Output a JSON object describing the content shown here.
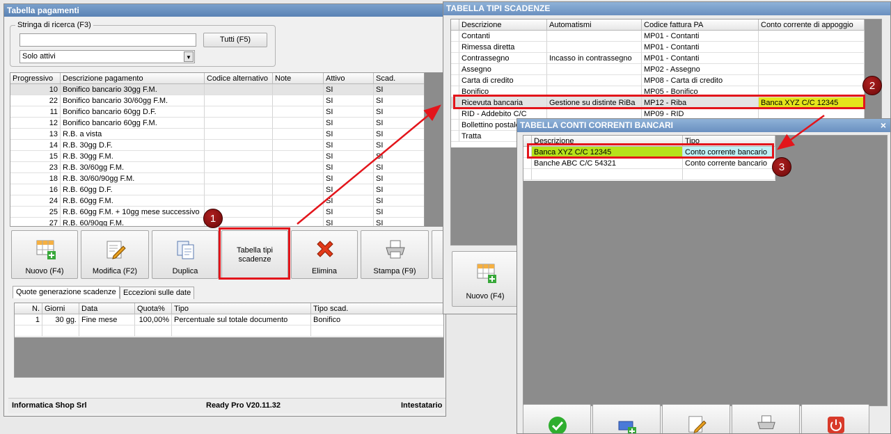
{
  "main": {
    "title": "Tabella pagamenti",
    "search": {
      "group_label": "Stringa di ricerca (F3)",
      "value": "",
      "all_button": "Tutti (F5)",
      "filter_value": "Solo attivi"
    },
    "table": {
      "headers": [
        "Progressivo",
        "Descrizione pagamento",
        "Codice alternativo",
        "Note",
        "Attivo",
        "Scad."
      ],
      "rows": [
        [
          "10",
          "Bonifico bancario 30gg F.M.",
          "",
          "",
          "SI",
          "SI"
        ],
        [
          "22",
          "Bonifico bancario 30/60gg F.M.",
          "",
          "",
          "SI",
          "SI"
        ],
        [
          "11",
          "Bonifico bancario 60gg D.F.",
          "",
          "",
          "SI",
          "SI"
        ],
        [
          "12",
          "Bonifico bancario 60gg F.M.",
          "",
          "",
          "SI",
          "SI"
        ],
        [
          "13",
          "R.B. a vista",
          "",
          "",
          "SI",
          "SI"
        ],
        [
          "14",
          "R.B. 30gg D.F.",
          "",
          "",
          "SI",
          "SI"
        ],
        [
          "15",
          "R.B. 30gg F.M.",
          "",
          "",
          "SI",
          "SI"
        ],
        [
          "23",
          "R.B. 30/60gg F.M.",
          "",
          "",
          "SI",
          "SI"
        ],
        [
          "18",
          "R.B. 30/60/90gg F.M.",
          "",
          "",
          "SI",
          "SI"
        ],
        [
          "16",
          "R.B. 60gg D.F.",
          "",
          "",
          "SI",
          "SI"
        ],
        [
          "24",
          "R.B. 60gg F.M.",
          "",
          "",
          "SI",
          "SI"
        ],
        [
          "25",
          "R.B. 60gg F.M. + 10gg mese successivo",
          "",
          "",
          "SI",
          "SI"
        ],
        [
          "27",
          "R.B. 60/90gg F.M.",
          "",
          "",
          "SI",
          "SI"
        ]
      ]
    },
    "toolbar": [
      "Nuovo (F4)",
      "Modifica (F2)",
      "Duplica",
      "Tabella tipi scadenze",
      "Elimina",
      "Stampa (F9)"
    ],
    "tabs": [
      "Quote generazione scadenze",
      "Eccezioni sulle date"
    ],
    "quote_table": {
      "headers": [
        "N.",
        "Giorni",
        "Data",
        "Quota%",
        "Tipo",
        "Tipo scad."
      ],
      "rows": [
        [
          "1",
          "30 gg.",
          "Fine mese",
          "100,00%",
          "Percentuale sul totale documento",
          "Bonifico"
        ]
      ]
    },
    "status": [
      "Informatica Shop Srl",
      "Ready Pro V20.11.32",
      "Intestatario licenza : CODICE S"
    ]
  },
  "scadenze": {
    "title": "TABELLA TIPI SCADENZE",
    "headers": [
      "Descrizione",
      "Automatismi",
      "Codice fattura PA",
      "Conto corrente di appoggio"
    ],
    "rows": [
      [
        "Contanti",
        "",
        "MP01 - Contanti",
        ""
      ],
      [
        "Rimessa diretta",
        "",
        "MP01 - Contanti",
        ""
      ],
      [
        "Contrassegno",
        "Incasso in contrassegno",
        "MP01 - Contanti",
        ""
      ],
      [
        "Assegno",
        "",
        "MP02 - Assegno",
        ""
      ],
      [
        "Carta di credito",
        "",
        "MP08 - Carta di credito",
        ""
      ],
      [
        "Bonifico",
        "",
        "MP05 - Bonifico",
        ""
      ],
      [
        "Ricevuta bancaria",
        "Gestione su distinte RiBa",
        "MP12 - Riba",
        "Banca XYZ C/C 12345"
      ],
      [
        "RID - Addebito C/C",
        "",
        "MP09 - RID",
        ""
      ],
      [
        "Bollettino postale",
        "",
        "",
        ""
      ],
      [
        "Tratta",
        "",
        "",
        ""
      ]
    ],
    "new_button": "Nuovo (F4)"
  },
  "conti": {
    "title": "TABELLA CONTI CORRENTI BANCARI",
    "close": "×",
    "headers": [
      "Descrizione",
      "Tipo"
    ],
    "rows": [
      [
        "Banca XYZ C/C 12345",
        "Conto corrente bancario"
      ],
      [
        "Banche ABC C/C 54321",
        "Conto corrente bancario"
      ]
    ]
  },
  "badges": [
    "1",
    "2",
    "3"
  ],
  "colors": {
    "highlight_yellow": "#e5e51a",
    "highlight_green": "#b6e21a",
    "highlight_cyan": "#bff2f6",
    "annotation_red": "#e3151b"
  },
  "icons": [
    "grid-add-icon",
    "edit-icon",
    "duplicate-icon",
    "delete-x-icon",
    "printer-icon",
    "check-icon",
    "power-icon"
  ]
}
